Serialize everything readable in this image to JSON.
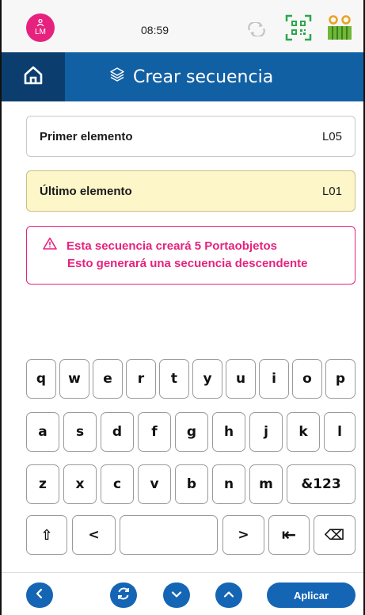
{
  "status": {
    "avatar_initials": "LM",
    "time": "08:59"
  },
  "header": {
    "title": "Crear secuencia"
  },
  "fields": {
    "first_label": "Primer elemento",
    "first_value": "L05",
    "last_label": "Último elemento",
    "last_value": "L01"
  },
  "warning": {
    "line1": "Esta secuencia creará 5 Portaobjetos",
    "line2": "Esto generará una secuencia descendente"
  },
  "keyboard": {
    "row1": [
      "q",
      "w",
      "e",
      "r",
      "t",
      "y",
      "u",
      "i",
      "o",
      "p"
    ],
    "row2": [
      "a",
      "s",
      "d",
      "f",
      "g",
      "h",
      "j",
      "k",
      "l"
    ],
    "row3": [
      "z",
      "x",
      "c",
      "v",
      "b",
      "n",
      "m",
      "&123"
    ],
    "row4": [
      "⇧",
      "<",
      "",
      ">",
      "⇤",
      "⌫"
    ]
  },
  "bottom": {
    "apply_label": "Aplicar"
  },
  "colors": {
    "primary": "#1260a4",
    "primary_dark": "#0b3e6e",
    "accent": "#e6227e",
    "highlight": "#fdf6c8"
  }
}
